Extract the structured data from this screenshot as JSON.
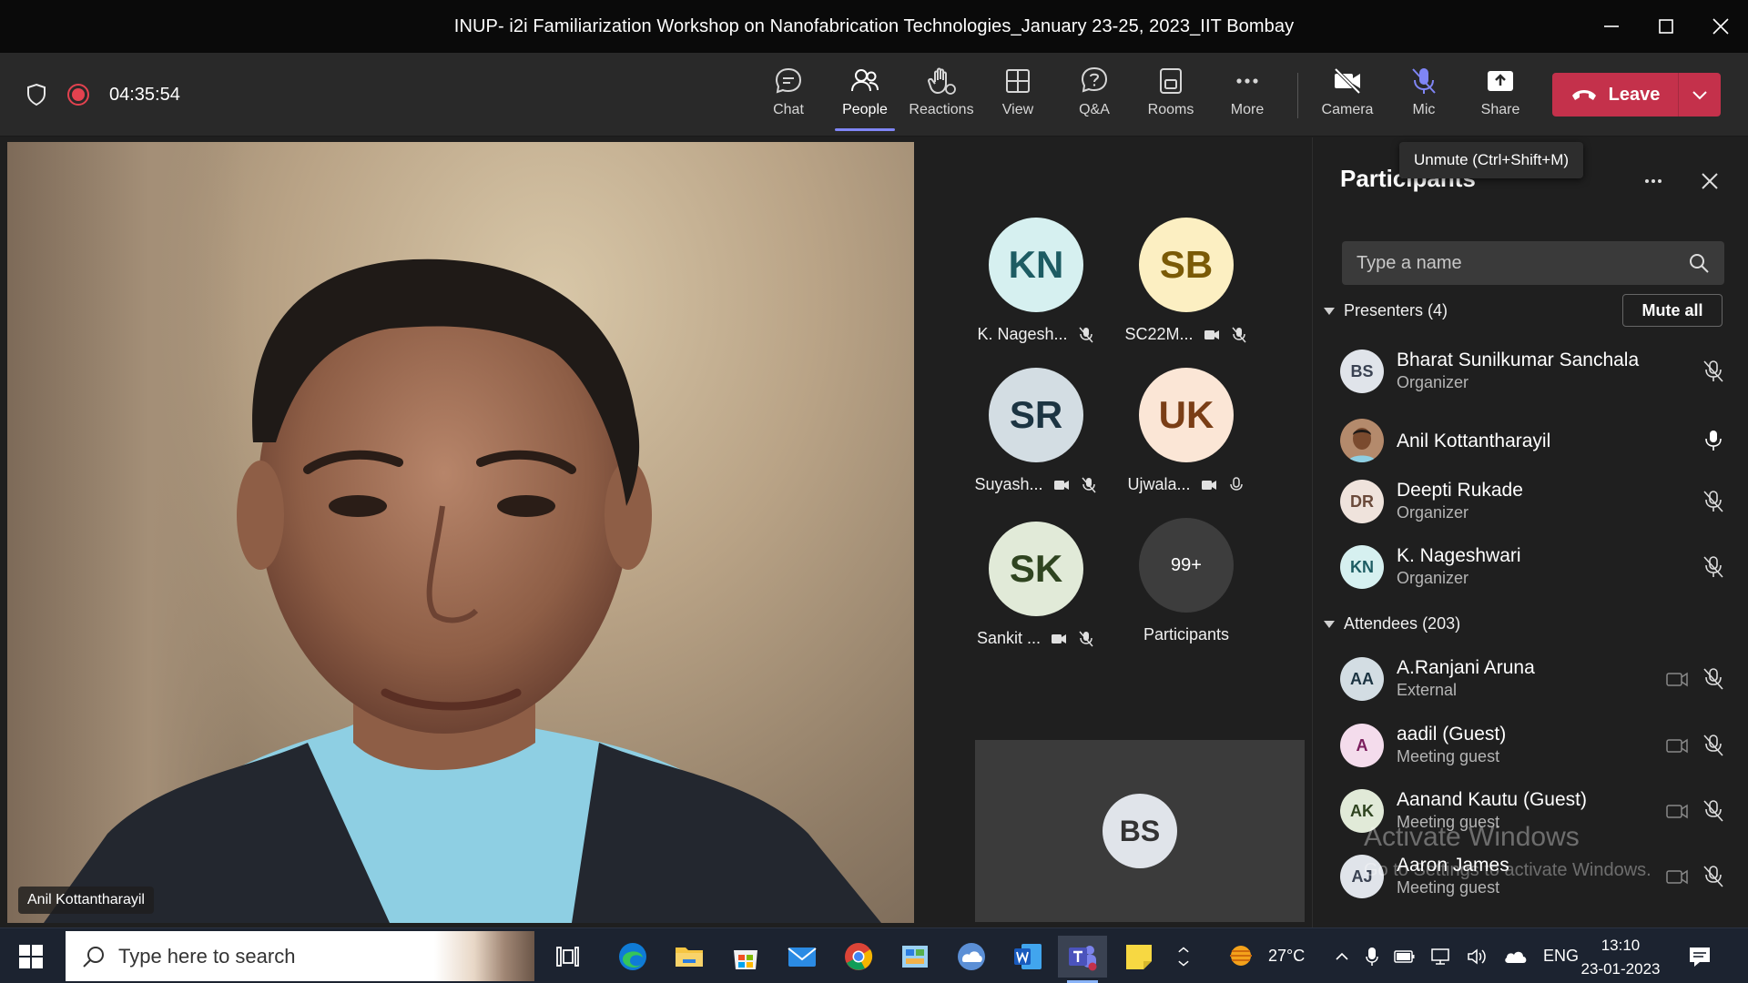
{
  "window": {
    "title": "INUP- i2i Familiarization Workshop on Nanofabrication Technologies_January 23-25, 2023_IIT Bombay"
  },
  "toolbar": {
    "timer": "04:35:54",
    "buttons": {
      "chat": "Chat",
      "people": "People",
      "reactions": "Reactions",
      "view": "View",
      "qa": "Q&A",
      "rooms": "Rooms",
      "more": "More",
      "camera": "Camera",
      "mic": "Mic",
      "share": "Share"
    },
    "leave_label": "Leave",
    "active_tab": "People"
  },
  "stage": {
    "main_speaker": "Anil Kottantharayil",
    "tiles": [
      {
        "initials": "KN",
        "name": "K. Nagesh...",
        "bg": "#d6f0f0",
        "fg": "#1d5c63"
      },
      {
        "initials": "SB",
        "name": "SC22M...",
        "bg": "#fcefc2",
        "fg": "#7a5a06"
      },
      {
        "initials": "SR",
        "name": "Suyash...",
        "bg": "#d3dde3",
        "fg": "#1c3442"
      },
      {
        "initials": "UK",
        "name": "Ujwala...",
        "bg": "#fbe6d6",
        "fg": "#7a3e16"
      },
      {
        "initials": "SK",
        "name": "Sankit ...",
        "bg": "#e1ead8",
        "fg": "#2f4420"
      }
    ],
    "overflow": {
      "count": "99+",
      "label": "Participants"
    },
    "self_view_initials": "BS"
  },
  "panel": {
    "title": "Participants",
    "tooltip": "Unmute (Ctrl+Shift+M)",
    "search_placeholder": "Type a name",
    "mute_all_label": "Mute all",
    "presenters_label": "Presenters (4)",
    "attendees_label": "Attendees (203)",
    "presenters": [
      {
        "initials": "BS",
        "name": "Bharat Sunilkumar Sanchala",
        "role": "Organizer",
        "bg": "#e0e4ea",
        "fg": "#3a4252"
      },
      {
        "initials": "",
        "name": "Anil Kottantharayil",
        "role": "",
        "bg": "#7a4a2e",
        "fg": "#ffffff"
      },
      {
        "initials": "DR",
        "name": "Deepti Rukade",
        "role": "Organizer",
        "bg": "#efe3dc",
        "fg": "#6a4a3a"
      },
      {
        "initials": "KN",
        "name": "K. Nageshwari",
        "role": "Organizer",
        "bg": "#d6f0f0",
        "fg": "#1d5c63"
      }
    ],
    "attendees": [
      {
        "initials": "AA",
        "name": "A.Ranjani Aruna",
        "role": "External",
        "bg": "#d3dde3",
        "fg": "#1c3442"
      },
      {
        "initials": "A",
        "name": "aadil (Guest)",
        "role": "Meeting guest",
        "bg": "#f4dcec",
        "fg": "#7a1d5c"
      },
      {
        "initials": "AK",
        "name": "Aanand Kautu (Guest)",
        "role": "Meeting guest",
        "bg": "#e1ead8",
        "fg": "#2f4420"
      },
      {
        "initials": "AJ",
        "name": "Aaron James",
        "role": "Meeting guest",
        "bg": "#e0e4ea",
        "fg": "#3a4252"
      }
    ],
    "watermark_title": "Activate Windows",
    "watermark_sub": "Go to Settings to activate Windows."
  },
  "taskbar": {
    "search_placeholder": "Type here to search",
    "weather": "27°C",
    "language": "ENG",
    "time": "13:10",
    "date": "23-01-2023"
  },
  "colors": {
    "accent": "#7f85f5",
    "leave": "#c4314b",
    "recording": "#e3424f"
  }
}
